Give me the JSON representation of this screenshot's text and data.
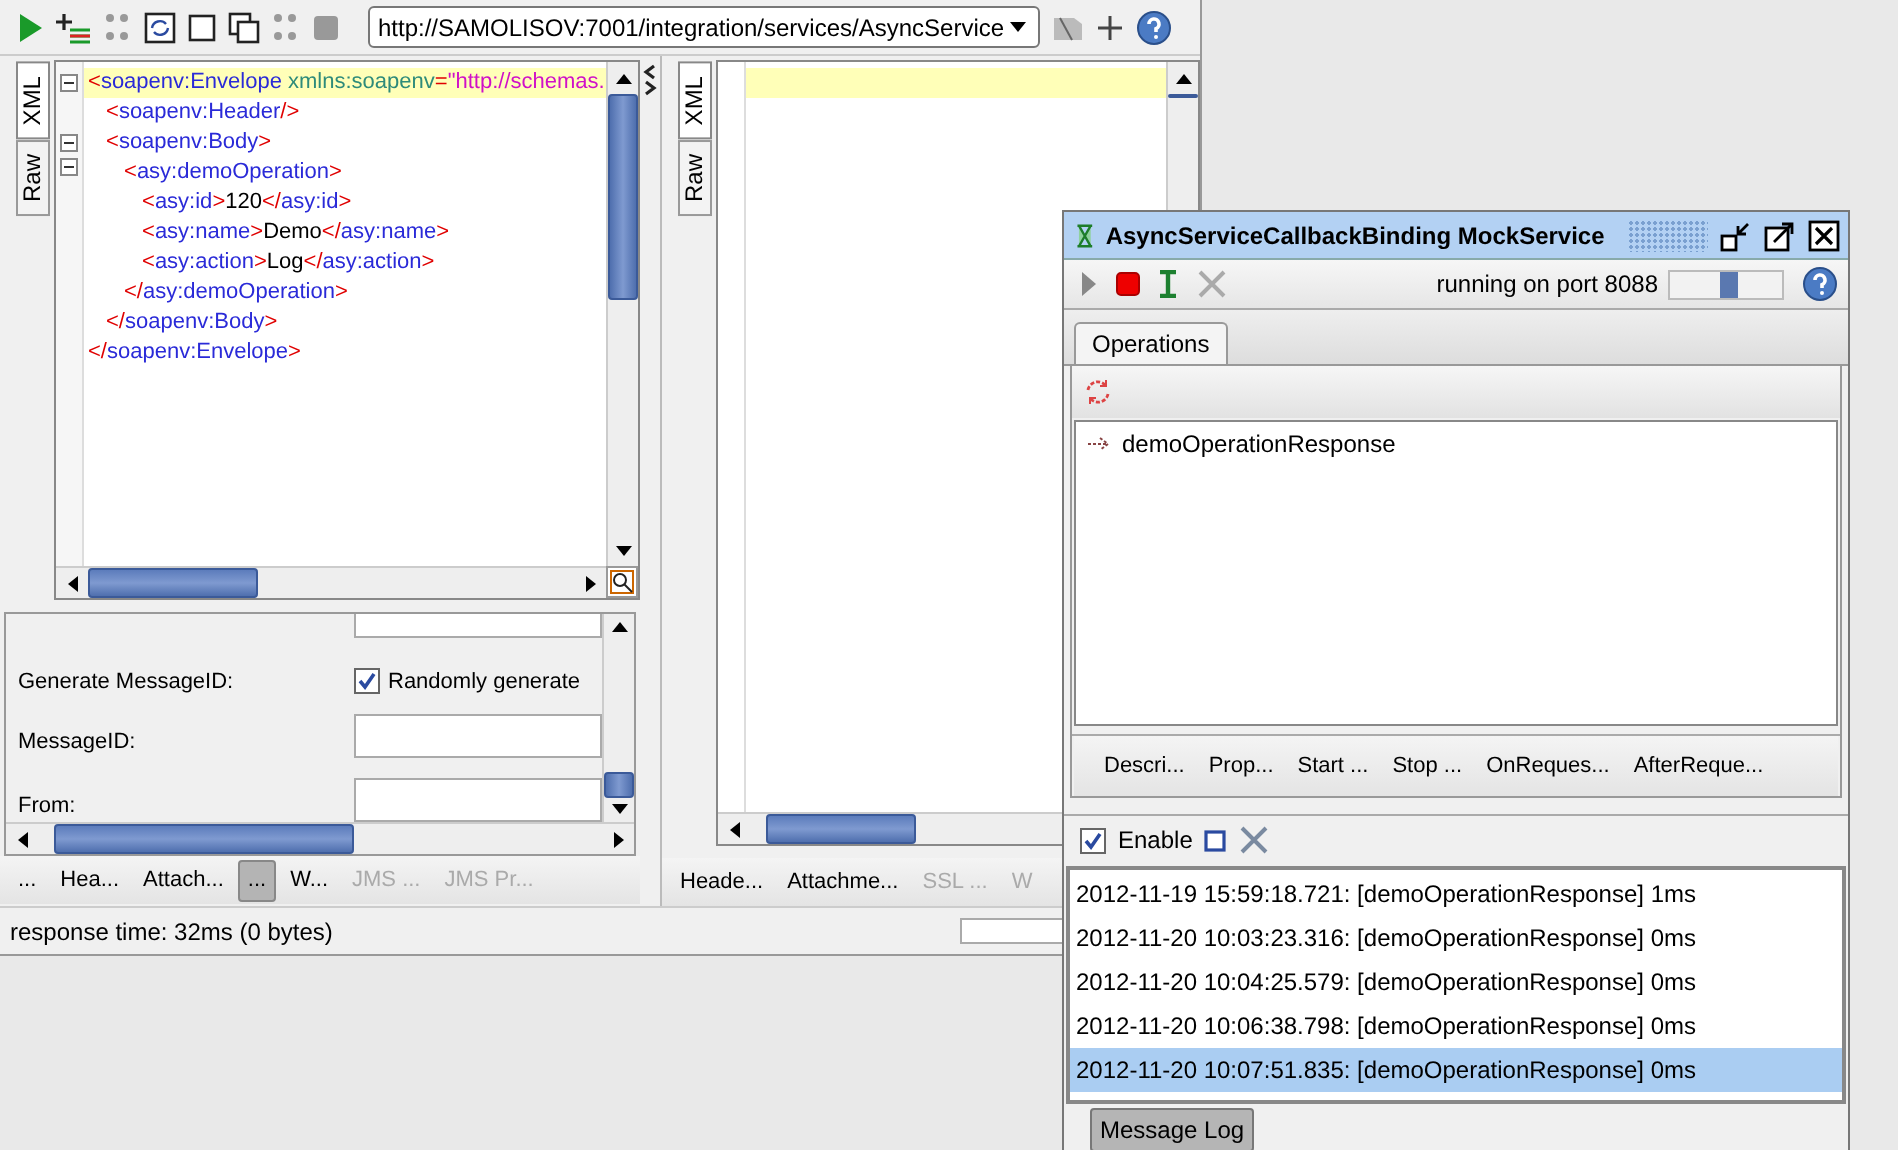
{
  "toolbar": {
    "endpoint": "http://SAMOLISOV:7001/integration/services/AsyncService"
  },
  "request": {
    "editor_tabs": [
      {
        "label": "XML",
        "selected": true
      },
      {
        "label": "Raw",
        "selected": false
      }
    ],
    "xml": [
      {
        "expanded": true,
        "open": [
          {
            "kind": "punct",
            "text": "<"
          },
          {
            "kind": "tag",
            "text": "soapenv:Envelope"
          },
          {
            "kind": "attr",
            "text": " xmlns:soapenv"
          },
          {
            "kind": "punct",
            "text": "="
          },
          {
            "kind": "value",
            "text": "\"http://schemas."
          }
        ],
        "children": [
          {
            "open": [
              {
                "kind": "punct",
                "text": "<"
              },
              {
                "kind": "tag",
                "text": "soapenv:Header"
              },
              {
                "kind": "punct",
                "text": "/>"
              }
            ]
          },
          {
            "expanded": true,
            "open": [
              {
                "kind": "punct",
                "text": "<"
              },
              {
                "kind": "tag",
                "text": "soapenv:Body"
              },
              {
                "kind": "punct",
                "text": ">"
              }
            ],
            "children": [
              {
                "expanded": true,
                "open": [
                  {
                    "kind": "punct",
                    "text": "<"
                  },
                  {
                    "kind": "tag",
                    "text": "asy:demoOperation"
                  },
                  {
                    "kind": "punct",
                    "text": ">"
                  }
                ],
                "children": [
                  {
                    "open": [
                      {
                        "kind": "punct",
                        "text": "<"
                      },
                      {
                        "kind": "tag",
                        "text": "asy:id"
                      },
                      {
                        "kind": "punct",
                        "text": ">"
                      },
                      {
                        "kind": "text",
                        "text": "120"
                      },
                      {
                        "kind": "punct",
                        "text": "</"
                      },
                      {
                        "kind": "tag",
                        "text": "asy:id"
                      },
                      {
                        "kind": "punct",
                        "text": ">"
                      }
                    ]
                  },
                  {
                    "open": [
                      {
                        "kind": "punct",
                        "text": "<"
                      },
                      {
                        "kind": "tag",
                        "text": "asy:name"
                      },
                      {
                        "kind": "punct",
                        "text": ">"
                      },
                      {
                        "kind": "text",
                        "text": "Demo"
                      },
                      {
                        "kind": "punct",
                        "text": "</"
                      },
                      {
                        "kind": "tag",
                        "text": "asy:name"
                      },
                      {
                        "kind": "punct",
                        "text": ">"
                      }
                    ]
                  },
                  {
                    "open": [
                      {
                        "kind": "punct",
                        "text": "<"
                      },
                      {
                        "kind": "tag",
                        "text": "asy:action"
                      },
                      {
                        "kind": "punct",
                        "text": ">"
                      },
                      {
                        "kind": "text",
                        "text": "Log"
                      },
                      {
                        "kind": "punct",
                        "text": "</"
                      },
                      {
                        "kind": "tag",
                        "text": "asy:action"
                      },
                      {
                        "kind": "punct",
                        "text": ">"
                      }
                    ]
                  }
                ],
                "close": [
                  {
                    "kind": "punct",
                    "text": "</"
                  },
                  {
                    "kind": "tag",
                    "text": "asy:demoOperation"
                  },
                  {
                    "kind": "punct",
                    "text": ">"
                  }
                ]
              }
            ],
            "close": [
              {
                "kind": "punct",
                "text": "</"
              },
              {
                "kind": "tag",
                "text": "soapenv:Body"
              },
              {
                "kind": "punct",
                "text": ">"
              }
            ]
          }
        ],
        "close": [
          {
            "kind": "punct",
            "text": "</"
          },
          {
            "kind": "tag",
            "text": "soapenv:Envelope"
          },
          {
            "kind": "punct",
            "text": ">"
          }
        ]
      }
    ],
    "properties": [
      {
        "kind": "checkbox",
        "label": "Generate MessageID:",
        "checked": true,
        "value": "Randomly generate"
      },
      {
        "kind": "field",
        "label": "MessageID:"
      },
      {
        "kind": "field",
        "label": "From:"
      }
    ],
    "tabs": [
      {
        "label": "...",
        "selected": false,
        "disabled": false
      },
      {
        "label": "Hea...",
        "selected": false,
        "disabled": false
      },
      {
        "label": "Attach...",
        "selected": false,
        "disabled": false
      },
      {
        "label": "...",
        "selected": true,
        "disabled": false
      },
      {
        "label": "W...",
        "selected": false,
        "disabled": false
      },
      {
        "label": "JMS ...",
        "selected": false,
        "disabled": true
      },
      {
        "label": "JMS Pr...",
        "selected": false,
        "disabled": true
      }
    ]
  },
  "response": {
    "editor_tabs": [
      {
        "label": "XML",
        "selected": true
      },
      {
        "label": "Raw",
        "selected": false
      }
    ],
    "tabs": [
      {
        "label": "Heade...",
        "selected": false,
        "disabled": false
      },
      {
        "label": "Attachme...",
        "selected": false,
        "disabled": false
      },
      {
        "label": "SSL ...",
        "selected": false,
        "disabled": true
      },
      {
        "label": "W",
        "selected": false,
        "disabled": true
      }
    ]
  },
  "status_bar": "response time: 32ms (0 bytes)",
  "progress": {
    "level": 0
  },
  "mock_window": {
    "title": "AsyncServiceCallbackBinding MockService",
    "status": "running on port 8088",
    "tabs": [
      {
        "label": "Operations",
        "selected": true
      }
    ],
    "operations": [
      {
        "name": "demoOperationResponse"
      }
    ],
    "operation_tabs": [
      {
        "label": "Descri...",
        "selected": false
      },
      {
        "label": "Prop...",
        "selected": false
      },
      {
        "label": "Start ...",
        "selected": false
      },
      {
        "label": "Stop ...",
        "selected": false
      },
      {
        "label": "OnReques...",
        "selected": false
      },
      {
        "label": "AfterReque...",
        "selected": false
      }
    ],
    "log_enabled": {
      "label": "Enable",
      "checked": true
    },
    "log": [
      {
        "text": "2012-11-19 15:59:18.721: [demoOperationResponse] 1ms",
        "selected": false
      },
      {
        "text": "2012-11-20 10:03:23.316: [demoOperationResponse] 0ms",
        "selected": false
      },
      {
        "text": "2012-11-20 10:04:25.579: [demoOperationResponse] 0ms",
        "selected": false
      },
      {
        "text": "2012-11-20 10:06:38.798: [demoOperationResponse] 0ms",
        "selected": false
      },
      {
        "text": "2012-11-20 10:07:51.835: [demoOperationResponse] 0ms",
        "selected": true
      }
    ],
    "bottom_tabs": [
      {
        "label": "Message Log",
        "selected": true
      }
    ]
  }
}
